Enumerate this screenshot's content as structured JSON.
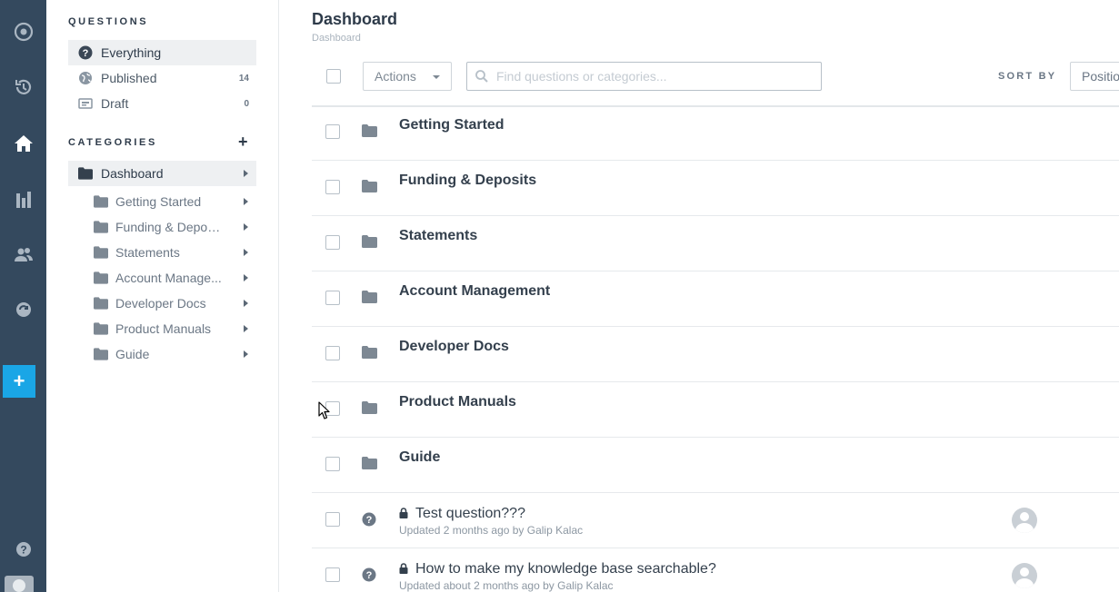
{
  "rail": {
    "icons": [
      "compass-icon",
      "history-icon",
      "home-icon",
      "bar-chart-icon",
      "users-icon",
      "globe-refresh-icon",
      "help-icon"
    ],
    "add_label": "+"
  },
  "sidebar": {
    "questions_heading": "QUESTIONS",
    "question_filters": [
      {
        "label": "Everything",
        "count": "",
        "icon": "question-circle-icon"
      },
      {
        "label": "Published",
        "count": "14",
        "icon": "globe-icon"
      },
      {
        "label": "Draft",
        "count": "0",
        "icon": "draft-icon"
      }
    ],
    "categories_heading": "CATEGORIES",
    "add_category_label": "+",
    "root_category": "Dashboard",
    "categories": [
      "Getting Started",
      "Funding & Deposits",
      "Statements",
      "Account Manage...",
      "Developer Docs",
      "Product Manuals",
      "Guide"
    ]
  },
  "main": {
    "title": "Dashboard",
    "breadcrumb": "Dashboard",
    "actions_label": "Actions",
    "search_placeholder": "Find questions or categories...",
    "sort_by_label": "SORT BY",
    "sort_value": "Position",
    "folders": [
      "Getting Started",
      "Funding & Deposits",
      "Statements",
      "Account Management",
      "Developer Docs",
      "Product Manuals",
      "Guide"
    ],
    "questions": [
      {
        "title": "Test question???",
        "meta": "Updated 2 months ago by Galip Kalac"
      },
      {
        "title": "How to make my knowledge base searchable?",
        "meta": "Updated about 2 months ago by Galip Kalac"
      }
    ]
  },
  "colors": {
    "rail_bg": "#34495e",
    "accent": "#1aa6e6",
    "selected_bg": "#eef0f2",
    "text_dark": "#2e3b4a"
  }
}
